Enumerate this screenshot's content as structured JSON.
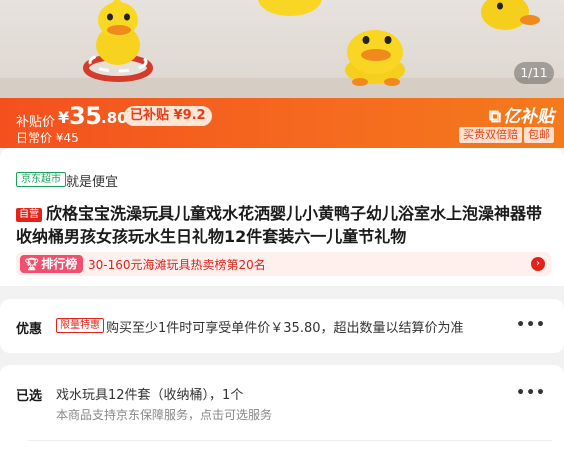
{
  "gallery": {
    "counter": "1/11"
  },
  "price_bar": {
    "subsidy_label": "补贴价",
    "currency": "¥",
    "price_integer": "35",
    "price_decimal": ".80",
    "subsidy_pill": "已补贴 ¥9.2",
    "daily_price": "日常价 ¥45",
    "brand_name": "亿补贴",
    "brand_tags": [
      "买贵双倍赔",
      "包邮"
    ]
  },
  "product": {
    "store_tag": "京东超市",
    "store_slogan": "就是便宜",
    "self_operated_tag": "自营",
    "title": "欣格宝宝洗澡玩具儿童戏水花洒婴儿小黄鸭子幼儿浴室水上泡澡神器带收纳桶男孩女孩玩水生日礼物12件套装六一儿童节礼物",
    "rank_badge": "排行榜",
    "rank_text": "30-160元海滩玩具热卖榜第20名"
  },
  "promo": {
    "label": "优惠",
    "tag": "限量特惠",
    "text": "购买至少1件时可享受单件价￥35.80，超出数量以结算价为准",
    "more": "•••"
  },
  "selected": {
    "label": "已选",
    "value": "戏水玩具12件套（收纳桶），1个",
    "service": "本商品支持京东保障服务，点击可选服务",
    "more": "•••"
  },
  "colors": {
    "accent": "#f4501e",
    "jd_red": "#e2231a",
    "store_green": "#1aa35b"
  }
}
